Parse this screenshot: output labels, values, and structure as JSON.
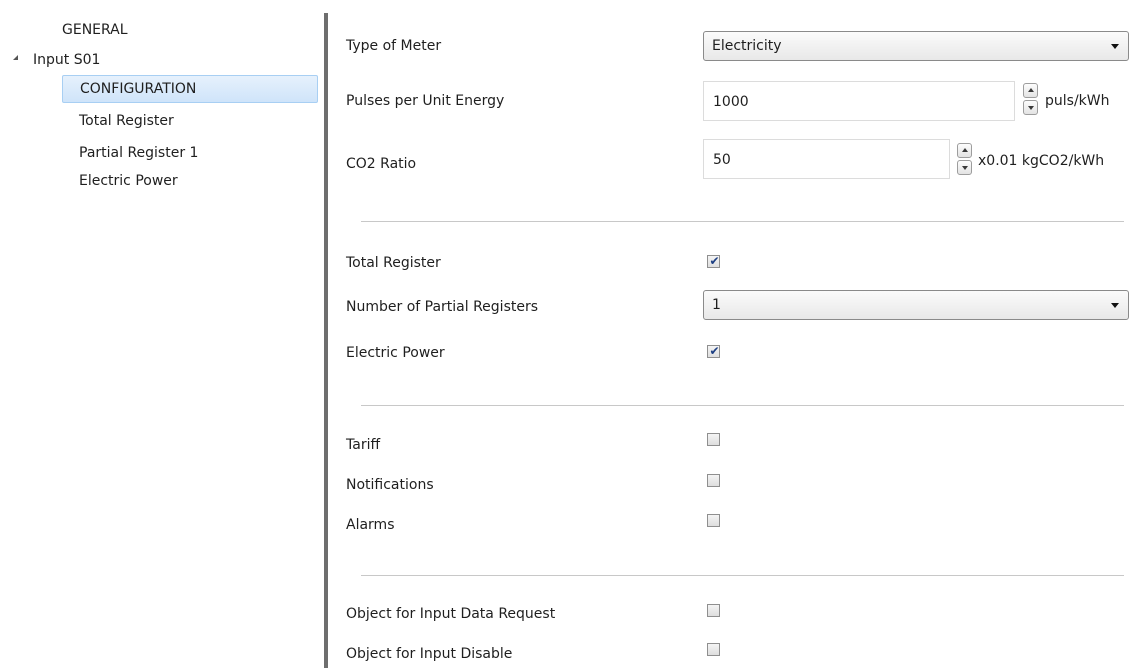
{
  "tree": {
    "items": [
      {
        "label": "GENERAL"
      },
      {
        "label": "Input S01"
      },
      {
        "label": "CONFIGURATION"
      },
      {
        "label": "Total Register"
      },
      {
        "label": "Partial Register 1"
      },
      {
        "label": "Electric Power"
      }
    ],
    "selected": "CONFIGURATION",
    "expander_icon": "triangle-expanded-icon"
  },
  "form": {
    "type_of_meter": {
      "label": "Type of Meter",
      "value": "Electricity"
    },
    "pulses_per_unit": {
      "label": "Pulses per Unit Energy",
      "value": "1000",
      "unit": "puls/kWh"
    },
    "co2_ratio": {
      "label": "CO2 Ratio",
      "value": "50",
      "unit": "x0.01 kgCO2/kWh"
    },
    "total_register": {
      "label": "Total Register",
      "checked": true
    },
    "num_partial_registers": {
      "label": "Number of Partial Registers",
      "value": "1"
    },
    "electric_power": {
      "label": "Electric Power",
      "checked": true
    },
    "tariff": {
      "label": "Tariff",
      "checked": false
    },
    "notifications": {
      "label": "Notifications",
      "checked": false
    },
    "alarms": {
      "label": "Alarms",
      "checked": false
    },
    "object_data_request": {
      "label": "Object for Input Data Request",
      "checked": false
    },
    "object_input_disable": {
      "label": "Object for Input Disable",
      "checked": false
    }
  },
  "colors": {
    "selection": "#cfe4fa",
    "check_mark": "#1c3e82",
    "splitter": "#6e6e6e"
  }
}
